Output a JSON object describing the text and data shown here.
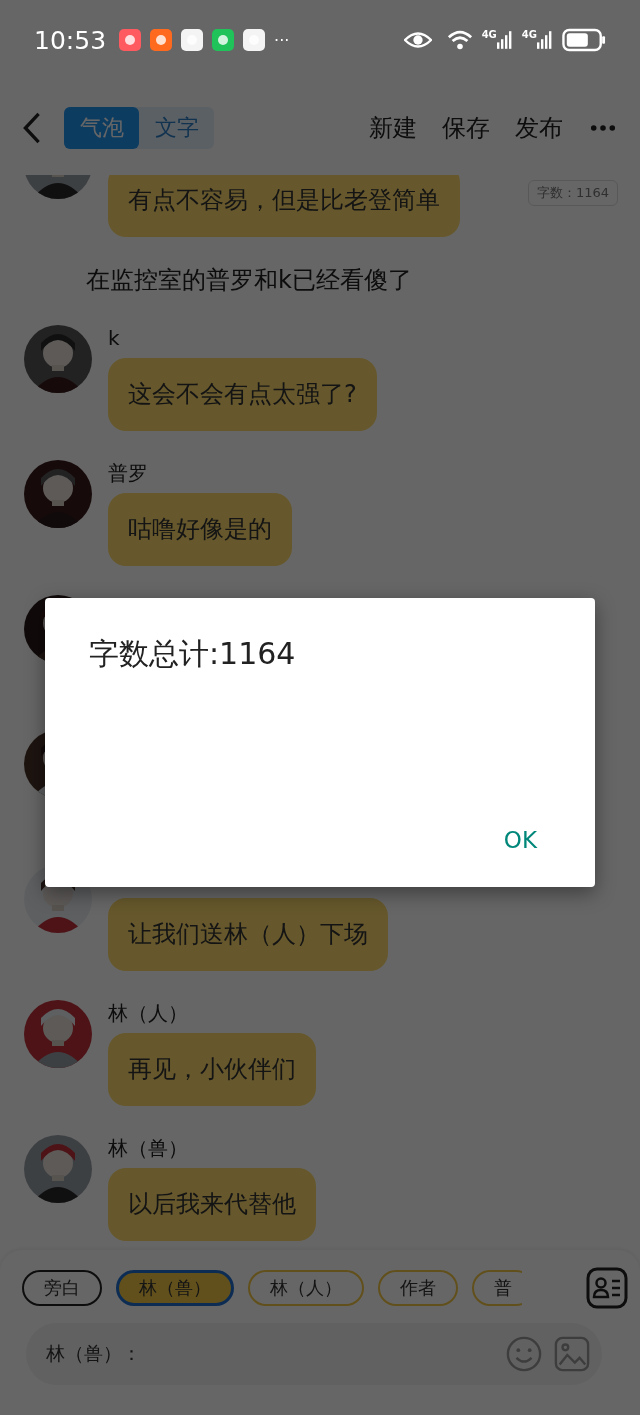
{
  "status_bar": {
    "time": "10:53",
    "more": "···",
    "signals": [
      "4G",
      "4G"
    ]
  },
  "header": {
    "tabs": [
      {
        "label": "气泡",
        "selected": true
      },
      {
        "label": "文字",
        "selected": false
      }
    ],
    "actions": [
      "新建",
      "保存",
      "发布"
    ]
  },
  "word_count_badge": "字数：1164",
  "chat": [
    {
      "kind": "message",
      "text": "有点不容易，但是比老登简单"
    },
    {
      "kind": "narration",
      "text": "在监控室的普罗和k已经看傻了"
    },
    {
      "kind": "message",
      "name": "k",
      "text": "这会不会有点太强了?"
    },
    {
      "kind": "message",
      "name": "普罗",
      "text": "咕噜好像是的"
    },
    {
      "kind": "message"
    },
    {
      "kind": "message"
    },
    {
      "kind": "message",
      "text": "让我们送林（人）下场"
    },
    {
      "kind": "message",
      "name": "林（人）",
      "text": "再见，小伙伴们"
    },
    {
      "kind": "message",
      "name": "林（兽）",
      "text": "以后我来代替他"
    }
  ],
  "roles": [
    {
      "kind": "narrator",
      "label": "旁白",
      "selected": false
    },
    {
      "kind": "role",
      "label": "林（兽）",
      "selected": true
    },
    {
      "kind": "role",
      "label": "林（人）",
      "selected": false
    },
    {
      "kind": "role",
      "label": "作者",
      "selected": false
    },
    {
      "kind": "role",
      "label": "普",
      "selected": false
    }
  ],
  "input": {
    "label": "林（兽）："
  },
  "dialog": {
    "title": "字数总计:1164",
    "button": "OK"
  }
}
